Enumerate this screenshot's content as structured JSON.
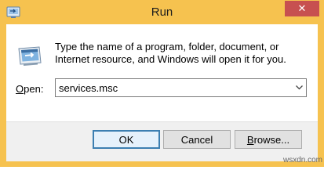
{
  "window": {
    "title": "Run",
    "close_glyph": "✕",
    "frame_color": "#f6c24f",
    "close_color": "#c75050"
  },
  "dialog": {
    "description": "Type the name of a program, folder, document, or Internet resource, and Windows will open it for you.",
    "open_label_accel": "O",
    "open_label_rest": "pen:",
    "open_value": "services.msc"
  },
  "buttons": {
    "ok": "OK",
    "cancel": "Cancel",
    "browse_accel": "B",
    "browse_rest": "rowse..."
  },
  "icons": {
    "app": "run-icon",
    "dropdown": "chevron-down-icon",
    "close": "close-icon"
  },
  "watermark": "wsxdn.com"
}
